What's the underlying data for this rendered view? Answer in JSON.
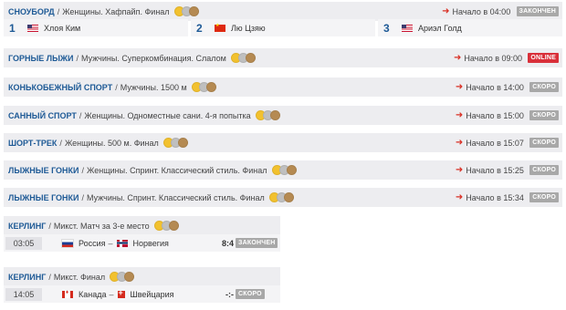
{
  "events": [
    {
      "sport": "СНОУБОРД",
      "desc": "Женщины. Хафпайп. Финал",
      "start": "Начало в 04:00",
      "badge": "ЗАКОНЧЕН"
    },
    {
      "sport": "ГОРНЫЕ ЛЫЖИ",
      "desc": "Мужчины. Суперкомбинация. Слалом",
      "start": "Начало в 09:00",
      "badge": "ONLINE"
    },
    {
      "sport": "КОНЬКОБЕЖНЫЙ СПОРТ",
      "desc": "Мужчины. 1500 м",
      "start": "Начало в 14:00",
      "badge": "СКОРО"
    },
    {
      "sport": "САННЫЙ СПОРТ",
      "desc": "Женщины. Одноместные сани. 4-я попытка",
      "start": "Начало в 15:00",
      "badge": "СКОРО"
    },
    {
      "sport": "ШОРТ-ТРЕК",
      "desc": "Женщины. 500 м. Финал",
      "start": "Начало в 15:07",
      "badge": "СКОРО"
    },
    {
      "sport": "ЛЫЖНЫЕ ГОНКИ",
      "desc": "Женщины. Спринт. Классический стиль. Финал",
      "start": "Начало в 15:25",
      "badge": "СКОРО"
    },
    {
      "sport": "ЛЫЖНЫЕ ГОНКИ",
      "desc": "Мужчины. Спринт. Классический стиль. Финал",
      "start": "Начало в 15:34",
      "badge": "СКОРО"
    },
    {
      "sport": "КЕРЛИНГ",
      "desc": "Микст. Матч за 3-е место"
    },
    {
      "sport": "КЕРЛИНГ",
      "desc": "Микст. Финал"
    }
  ],
  "podium": [
    {
      "place": "1",
      "flag": "us-flag",
      "name": "Хлоя Ким"
    },
    {
      "place": "2",
      "flag": "cn-flag",
      "name": "Лю Цзяю"
    },
    {
      "place": "3",
      "flag": "us-flag",
      "name": "Ариэл Голд"
    }
  ],
  "matches": [
    {
      "time": "03:05",
      "team1": "Россия",
      "team2": "Норвегия",
      "score": "8:4",
      "badge": "ЗАКОНЧЕН",
      "team1_flag": "ru-flag",
      "team2_flag": "no-flag"
    },
    {
      "time": "14:05",
      "team1": "Канада",
      "team2": "Швейцария",
      "score": "-:-",
      "badge": "СКОРО",
      "team1_flag": "ca-flag",
      "team2_flag": "ch-flag"
    }
  ],
  "separator": "/",
  "team_dash": "–",
  "colors": {
    "sport": "#1e5a96",
    "row_bg": "#ededf0",
    "online": "#d9303a",
    "badge": "#a8a8a8",
    "arrow": "#d93025",
    "gold": "#f2c12e",
    "silver": "#bfbfbf",
    "bronze": "#b58a52"
  }
}
